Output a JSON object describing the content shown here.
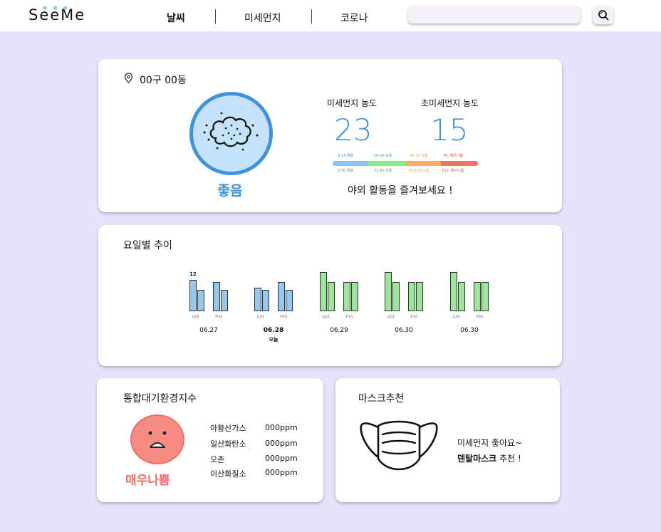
{
  "header": {
    "logo": "SeeMe",
    "nav": [
      {
        "label": "날씨",
        "active": true
      },
      {
        "label": "미세먼지",
        "active": false
      },
      {
        "label": "코로나",
        "active": false
      }
    ],
    "search": {
      "placeholder": "",
      "value": ""
    },
    "search_icon": "search-icon"
  },
  "current": {
    "location": "00구 00동",
    "location_icon": "map-pin-icon",
    "status_icon": "cloud-dust-icon",
    "status": "좋음",
    "pm10": {
      "label": "미세먼지 농도",
      "value": "23"
    },
    "pm25": {
      "label": "초미세먼지 농도",
      "value": "15"
    },
    "scale_top": [
      {
        "text": "0-15 좋음",
        "color": "#4a90d9"
      },
      {
        "text": "16-35 보통",
        "color": "#3fb54a"
      },
      {
        "text": "36-75 나쁨",
        "color": "#f0a23a"
      },
      {
        "text": "76- 매우나쁨",
        "color": "#e84a4a"
      }
    ],
    "scale_bottom": [
      {
        "text": "0-30 좋음",
        "color": "#4a90d9"
      },
      {
        "text": "31-80 보통",
        "color": "#3fb54a"
      },
      {
        "text": "81-150 나쁨",
        "color": "#f0a23a"
      },
      {
        "text": "151- 매우나쁨",
        "color": "#e84a4a"
      }
    ],
    "scale_colors": [
      "#8fc2ef",
      "#8fe68c",
      "#f6b15c",
      "#f26f6a"
    ],
    "message": "야외 활동을 즐겨보세요 !"
  },
  "weekly": {
    "title": "요일별 추이",
    "am_label": "AM",
    "pm_label": "PM",
    "first_value_label": "12",
    "days": [
      {
        "date": "06.27",
        "sub": "",
        "bold": false,
        "color": "blue",
        "am": [
          12,
          8
        ],
        "pm": [
          11,
          8
        ]
      },
      {
        "date": "06.28",
        "sub": "오늘",
        "bold": true,
        "color": "blue",
        "am": [
          9,
          8
        ],
        "pm": [
          11,
          8
        ]
      },
      {
        "date": "06.29",
        "sub": "",
        "bold": false,
        "color": "green",
        "am": [
          15,
          11
        ],
        "pm": [
          11,
          11
        ]
      },
      {
        "date": "06.30",
        "sub": "",
        "bold": false,
        "color": "green",
        "am": [
          15,
          11
        ],
        "pm": [
          11,
          11
        ]
      },
      {
        "date": "06.30",
        "sub": "",
        "bold": false,
        "color": "green",
        "am": [
          15,
          11
        ],
        "pm": [
          11,
          11
        ]
      }
    ]
  },
  "air_quality": {
    "title": "통합대기환경지수",
    "face_icon": "sad-face-icon",
    "status": "매우나쁨",
    "status_color": "#ef6e67",
    "items": [
      {
        "name": "아황산가스",
        "value": "000ppm"
      },
      {
        "name": "일산화탄소",
        "value": "000ppm"
      },
      {
        "name": "오존",
        "value": "000ppm"
      },
      {
        "name": "이산화질소",
        "value": "000ppm"
      }
    ]
  },
  "mask": {
    "title": "마스크추천",
    "icon": "face-mask-icon",
    "line1": "미세먼지 좋아요~",
    "line2_bold": "덴탈마스크",
    "line2_rest": " 추천 !"
  }
}
